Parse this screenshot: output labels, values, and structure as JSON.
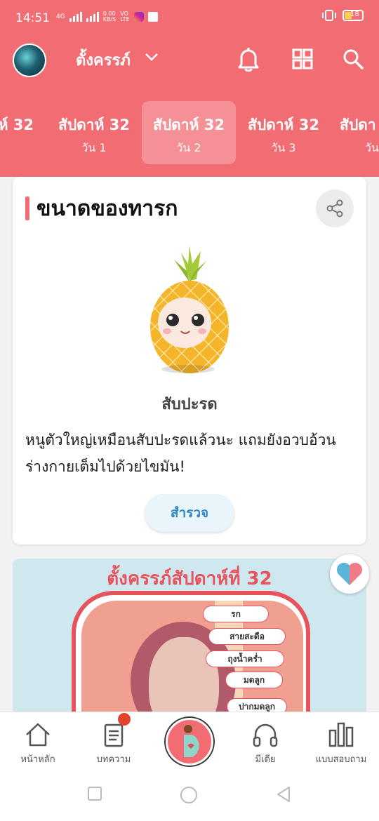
{
  "status_bar": {
    "time": "14:51",
    "network_label": "4G",
    "speed": "0.00\nKB/S",
    "volte": "VO\nLTE",
    "battery": "18"
  },
  "app_bar": {
    "title": "ตั้งครรภ์",
    "icons": [
      "bell-icon",
      "grid-icon",
      "search-icon"
    ]
  },
  "week_tabs": [
    {
      "week": "ห์ 32",
      "day": ""
    },
    {
      "week": "สัปดาห์ 32",
      "day": "วัน 1"
    },
    {
      "week": "สัปดาห์ 32",
      "day": "วัน 2",
      "active": true
    },
    {
      "week": "สัปดาห์ 32",
      "day": "วัน 3"
    },
    {
      "week": "สัปดา",
      "day": "วัน"
    }
  ],
  "baby_size": {
    "heading": "ขนาดของทารก",
    "fruit": "สับปะรด",
    "description": "หนูตัวใหญ่เหมือนสับปะรดแล้วนะ แถมยังอวบอ้วน ร่างกายเต็มไปด้วยไขมัน!",
    "explore_label": "สำรวจ"
  },
  "infographic": {
    "title": "ตั้งครรภ์สัปดาห์ที่ 32",
    "labels": [
      "รก",
      "สายสะดือ",
      "ถุงน้ำคร่ำ",
      "มดลูก",
      "ปากมดลูก"
    ]
  },
  "bottom_nav": [
    {
      "label": "หน้าหลัก",
      "icon": "home-icon"
    },
    {
      "label": "บทความ",
      "icon": "article-icon",
      "badge": true
    },
    {
      "label": "",
      "icon": "pregnancy-icon"
    },
    {
      "label": "มีเดีย",
      "icon": "headphones-icon"
    },
    {
      "label": "แบบสอบถาม",
      "icon": "poll-icon"
    }
  ],
  "colors": {
    "brand": "#f26c73",
    "link": "#2f86c4",
    "badge": "#e0452b"
  }
}
